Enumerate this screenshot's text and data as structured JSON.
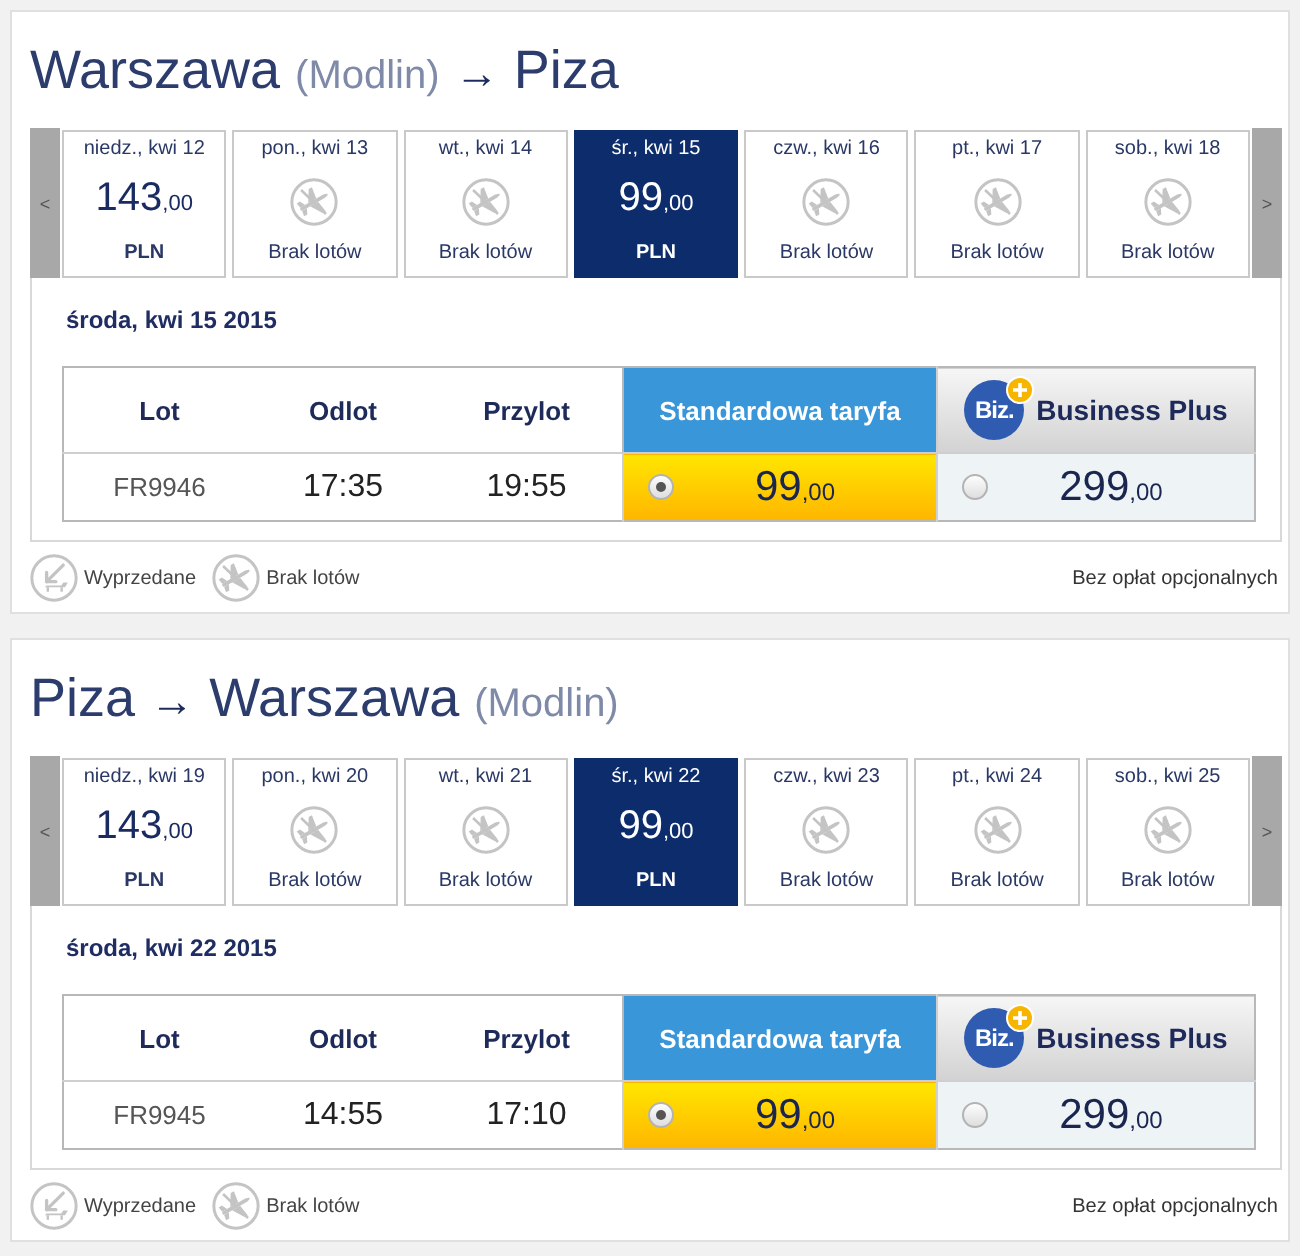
{
  "flights": [
    {
      "title": [
        {
          "kind": "city",
          "text": "Warszawa"
        },
        {
          "kind": "airport",
          "text": "(Modlin)"
        },
        {
          "kind": "arrow",
          "text": "→"
        },
        {
          "kind": "city",
          "text": "Piza"
        }
      ],
      "date_strip": {
        "prev": "<",
        "next": ">",
        "days": [
          {
            "date": "niedz., kwi 12",
            "kind": "price",
            "price": "143",
            "decimals": ",00",
            "currency": "PLN",
            "selected": false
          },
          {
            "date": "pon., kwi 13",
            "kind": "no_flights",
            "status": "Brak lotów",
            "selected": false
          },
          {
            "date": "wt., kwi 14",
            "kind": "no_flights",
            "status": "Brak lotów",
            "selected": false
          },
          {
            "date": "śr., kwi 15",
            "kind": "price",
            "price": "99",
            "decimals": ",00",
            "currency": "PLN",
            "selected": true
          },
          {
            "date": "czw., kwi 16",
            "kind": "no_flights",
            "status": "Brak lotów",
            "selected": false
          },
          {
            "date": "pt., kwi 17",
            "kind": "no_flights",
            "status": "Brak lotów",
            "selected": false
          },
          {
            "date": "sob., kwi 18",
            "kind": "no_flights",
            "status": "Brak lotów",
            "selected": false
          }
        ]
      },
      "selected_date": "środa, kwi 15 2015",
      "table": {
        "columns": [
          {
            "kind": "plain",
            "label": "Lot"
          },
          {
            "kind": "plain",
            "label": "Odlot"
          },
          {
            "kind": "plain",
            "label": "Przylot"
          },
          {
            "kind": "standard",
            "label": "Standardowa taryfa"
          },
          {
            "kind": "business",
            "label": "Business Plus",
            "logo": "Biz."
          }
        ],
        "rows": [
          {
            "flight": "FR9946",
            "departure": "17:35",
            "arrival": "19:55",
            "fares": [
              {
                "price": "99",
                "decimals": ",00",
                "selected": true
              },
              {
                "price": "299",
                "decimals": ",00",
                "selected": false
              }
            ]
          }
        ]
      },
      "legend": [
        {
          "kind": "sold_out",
          "label": "Wyprzedane"
        },
        {
          "kind": "no_flights",
          "label": "Brak lotów"
        }
      ],
      "note": "Bez opłat opcjonalnych"
    },
    {
      "title": [
        {
          "kind": "city",
          "text": "Piza"
        },
        {
          "kind": "arrow",
          "text": "→"
        },
        {
          "kind": "city",
          "text": "Warszawa"
        },
        {
          "kind": "airport",
          "text": "(Modlin)"
        }
      ],
      "date_strip": {
        "prev": "<",
        "next": ">",
        "days": [
          {
            "date": "niedz., kwi 19",
            "kind": "price",
            "price": "143",
            "decimals": ",00",
            "currency": "PLN",
            "selected": false
          },
          {
            "date": "pon., kwi 20",
            "kind": "no_flights",
            "status": "Brak lotów",
            "selected": false
          },
          {
            "date": "wt., kwi 21",
            "kind": "no_flights",
            "status": "Brak lotów",
            "selected": false
          },
          {
            "date": "śr., kwi 22",
            "kind": "price",
            "price": "99",
            "decimals": ",00",
            "currency": "PLN",
            "selected": true
          },
          {
            "date": "czw., kwi 23",
            "kind": "no_flights",
            "status": "Brak lotów",
            "selected": false
          },
          {
            "date": "pt., kwi 24",
            "kind": "no_flights",
            "status": "Brak lotów",
            "selected": false
          },
          {
            "date": "sob., kwi 25",
            "kind": "no_flights",
            "status": "Brak lotów",
            "selected": false
          }
        ]
      },
      "selected_date": "środa, kwi 22 2015",
      "table": {
        "columns": [
          {
            "kind": "plain",
            "label": "Lot"
          },
          {
            "kind": "plain",
            "label": "Odlot"
          },
          {
            "kind": "plain",
            "label": "Przylot"
          },
          {
            "kind": "standard",
            "label": "Standardowa taryfa"
          },
          {
            "kind": "business",
            "label": "Business Plus",
            "logo": "Biz."
          }
        ],
        "rows": [
          {
            "flight": "FR9945",
            "departure": "14:55",
            "arrival": "17:10",
            "fares": [
              {
                "price": "99",
                "decimals": ",00",
                "selected": true
              },
              {
                "price": "299",
                "decimals": ",00",
                "selected": false
              }
            ]
          }
        ]
      },
      "legend": [
        {
          "kind": "sold_out",
          "label": "Wyprzedane"
        },
        {
          "kind": "no_flights",
          "label": "Brak lotów"
        }
      ],
      "note": "Bez opłat opcjonalnych"
    }
  ]
}
